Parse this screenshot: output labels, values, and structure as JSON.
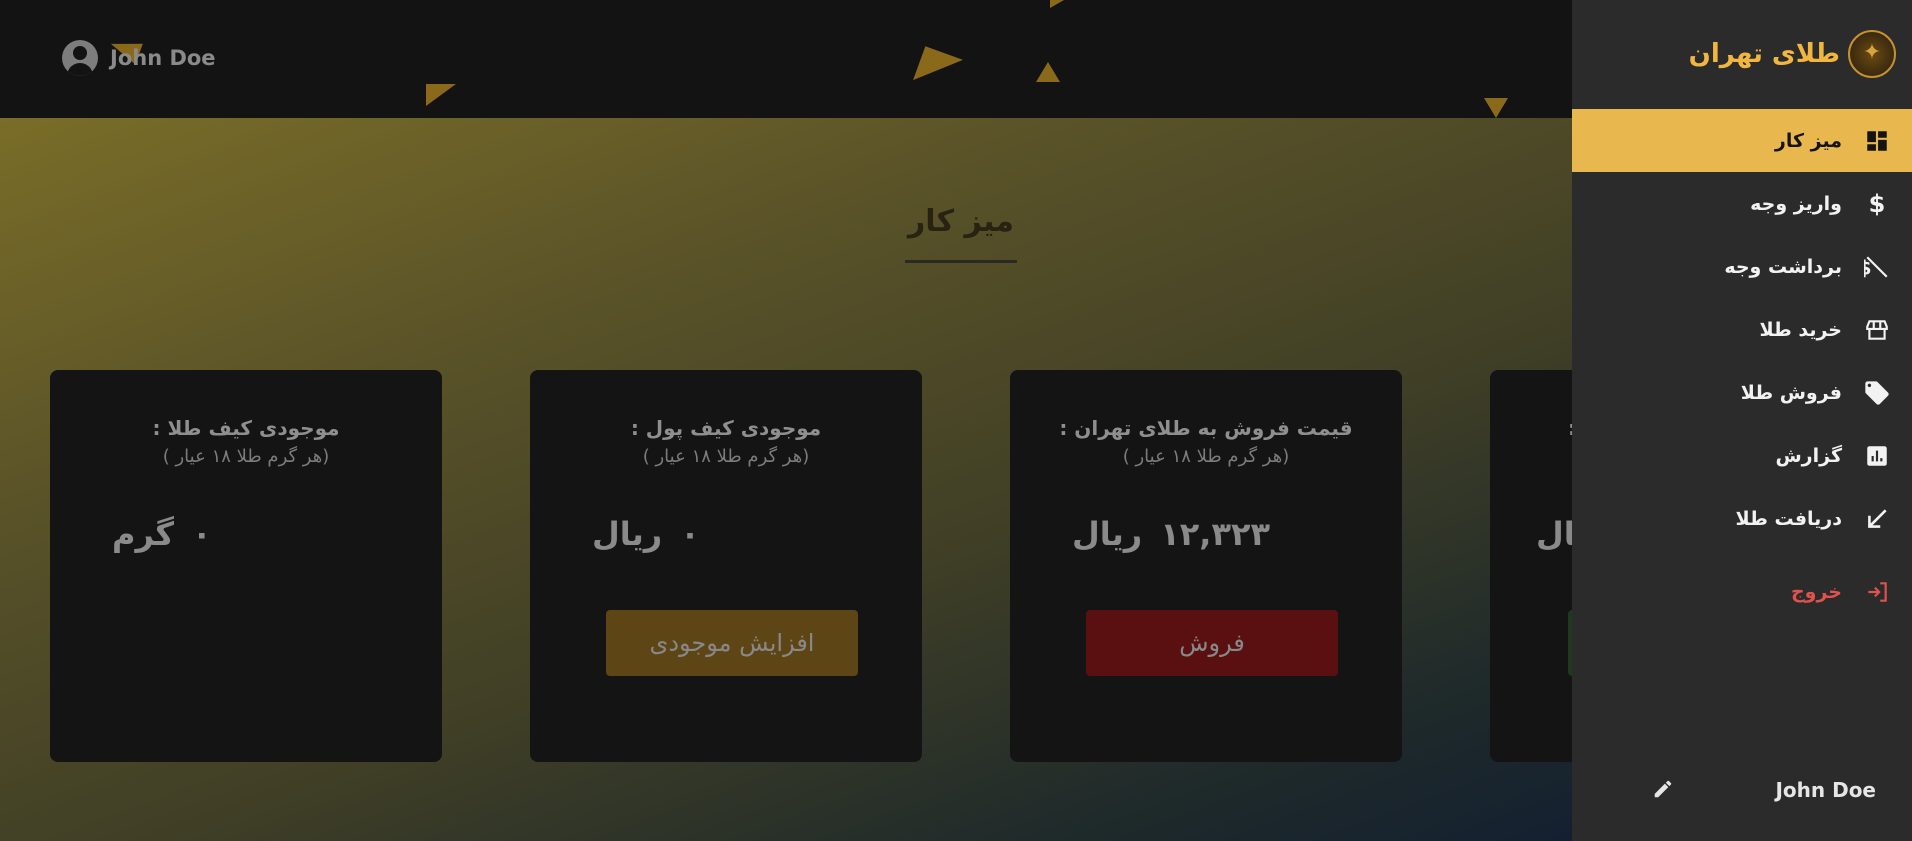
{
  "header": {
    "user_name": "John Doe"
  },
  "page": {
    "title": "میز کار"
  },
  "cards": [
    {
      "label": "موجودی کیف طلا :",
      "sub": "(هر گرم طلا ۱۸ عیار )",
      "value": "۰",
      "unit": "گرم",
      "button": ""
    },
    {
      "label": "موجودی کیف پول :",
      "sub": "(هر گرم طلا ۱۸ عیار )",
      "value": "۰",
      "unit": "ریال",
      "button": "افزایش موجودی"
    },
    {
      "label": "قیمت فروش به طلای تهران :",
      "sub": "(هر گرم طلا ۱۸ عیار )",
      "value": "۱۲,۳۲۳",
      "unit": "ریال",
      "button": "فروش"
    },
    {
      "label": ":",
      "sub": "",
      "value": "",
      "unit": "یال",
      "button": ""
    }
  ],
  "sidebar": {
    "brand": "طلای تهران",
    "items": [
      {
        "label": "میز کار",
        "icon": "dashboard-icon"
      },
      {
        "label": "واریز وجه",
        "icon": "dollar-icon"
      },
      {
        "label": "برداشت وجه",
        "icon": "money-off-icon"
      },
      {
        "label": "خرید طلا",
        "icon": "store-icon"
      },
      {
        "label": "فروش طلا",
        "icon": "tag-icon"
      },
      {
        "label": "گزارش",
        "icon": "report-icon"
      },
      {
        "label": "دریافت طلا",
        "icon": "arrow-down-left-icon"
      }
    ],
    "logout": "خروج",
    "user_name": "John Doe"
  },
  "colors": {
    "accent": "#e8b84e",
    "brand": "#f0b640",
    "danger": "#e0524e",
    "sell_button": "#5a1010",
    "increase_button": "#5e4516",
    "buy_button": "#1e3a1e"
  }
}
